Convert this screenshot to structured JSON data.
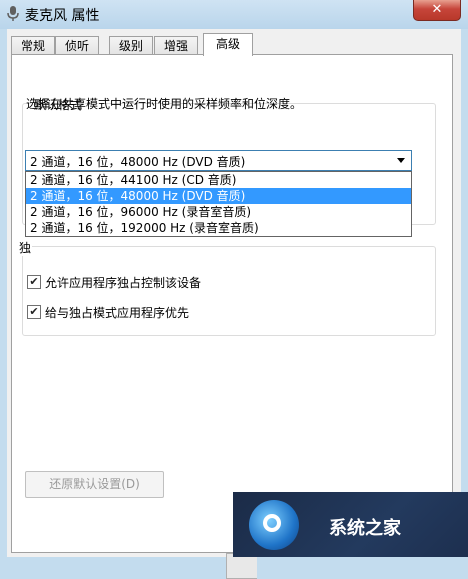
{
  "window": {
    "title": "麦克风 属性",
    "close_label": "✕"
  },
  "tabs": [
    {
      "label": "常规"
    },
    {
      "label": "侦听"
    },
    {
      "label": "级别"
    },
    {
      "label": "增强"
    },
    {
      "label": "高级"
    }
  ],
  "active_tab": "高级",
  "default_format": {
    "title": "默认格式",
    "description": "选择在共享模式中运行时使用的采样频率和位深度。",
    "selected": "2 通道，16 位，48000 Hz (DVD 音质)",
    "options": [
      "2 通道，16 位，44100 Hz (CD 音质)",
      "2 通道，16 位，48000 Hz (DVD 音质)",
      "2 通道，16 位，96000 Hz (录音室音质)",
      "2 通道，16 位，192000 Hz (录音室音质)"
    ]
  },
  "exclusive_mode": {
    "title_fragment": "独",
    "allow_exclusive": {
      "label": "允许应用程序独占控制该设备",
      "checked": true
    },
    "give_priority": {
      "label": "给与独占模式应用程序优先",
      "checked": true
    }
  },
  "restore_defaults_label": "还原默认设置(D)",
  "watermark": {
    "text": "系统之家"
  },
  "colors": {
    "selection": "#3399ff",
    "close_button": "#c6453a",
    "titlebar": "#c3dcee"
  }
}
